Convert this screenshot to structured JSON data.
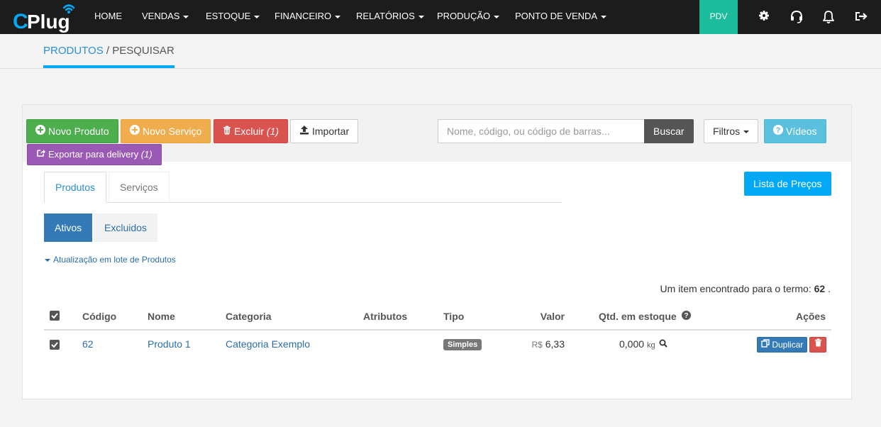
{
  "brand": {
    "logo_text": "CPlug",
    "accent": "#03a9f4"
  },
  "navbar": {
    "items": [
      {
        "label": "HOME",
        "dropdown": false
      },
      {
        "label": "VENDAS",
        "dropdown": true
      },
      {
        "label": "ESTOQUE",
        "dropdown": true
      },
      {
        "label": "FINANCEIRO",
        "dropdown": true
      },
      {
        "label": "RELATÓRIOS",
        "dropdown": true
      },
      {
        "label": "PRODUÇÃO",
        "dropdown": true
      },
      {
        "label": "PONTO DE VENDA",
        "dropdown": true
      }
    ],
    "pdv_label": "PDV",
    "icons": [
      "gear-icon",
      "headset-icon",
      "bell-icon",
      "sign-out-icon"
    ]
  },
  "breadcrumb": {
    "section": "PRODUTOS",
    "separator": " / ",
    "current": "PESQUISAR"
  },
  "toolbar": {
    "novo_produto": "Novo Produto",
    "novo_servico": "Novo Serviço",
    "excluir": "Excluir",
    "excluir_count": "(1)",
    "importar": "Importar",
    "exportar": "Exportar para delivery",
    "exportar_count": "(1)",
    "search_placeholder": "Nome, código, ou código de barras...",
    "buscar": "Buscar",
    "filtros": "Filtros",
    "videos": "Vídeos",
    "lista_precos": "Lista de Preços"
  },
  "tabs": [
    {
      "label": "Produtos",
      "active": true
    },
    {
      "label": "Serviços",
      "active": false
    }
  ],
  "status_pills": [
    {
      "label": "Ativos",
      "active": true
    },
    {
      "label": "Excluidos",
      "active": false
    }
  ],
  "lote_link": "Atualização em lote de Produtos",
  "result": {
    "text": "Um item encontrado para o termo:",
    "term": "62",
    "suffix": "."
  },
  "table": {
    "columns": [
      "Código",
      "Nome",
      "Categoria",
      "Atributos",
      "Tipo",
      "Valor",
      "Qtd. em estoque",
      "Ações"
    ],
    "rows": [
      {
        "checked": true,
        "codigo": "62",
        "nome": "Produto 1",
        "categoria": "Categoria Exemplo",
        "atributos": "",
        "tipo": "Simples",
        "currency": "R$",
        "valor": "6,33",
        "qtd": "0,000",
        "unidade": "kg",
        "duplicar": "Duplicar"
      }
    ]
  },
  "colors": {
    "green": "#4cae4c",
    "orange": "#f0ad4e",
    "red": "#d9534f",
    "purple": "#9b59b6",
    "info": "#5bc0de",
    "primary": "#337ab7",
    "pdv": "#1abc9c"
  }
}
